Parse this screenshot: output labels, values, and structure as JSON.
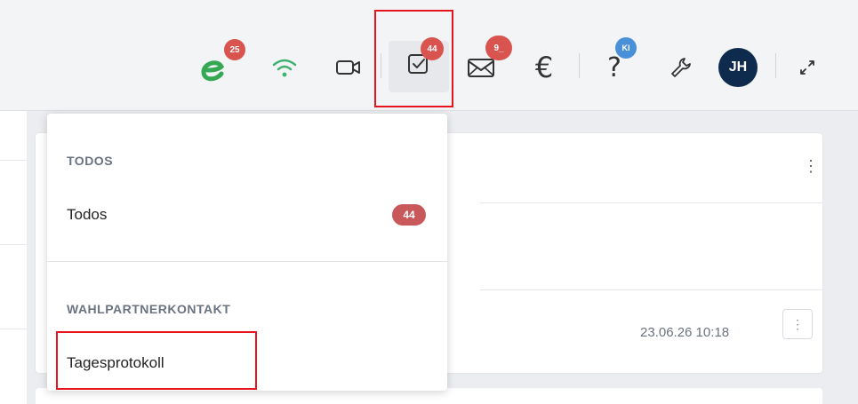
{
  "toolbar": {
    "e_badge": "25",
    "todo_badge": "44",
    "mail_badge": "9_",
    "help_badge": "KI",
    "euro_symbol": "€",
    "help_symbol": "?",
    "avatar_initials": "JH",
    "e_color": "#35a853",
    "wifi_color": "#3cb371",
    "badge_color": "#d9534f",
    "highlight_color": "#e5141d"
  },
  "dropdown": {
    "sections": [
      {
        "title": "TODOS",
        "items": [
          {
            "label": "Todos",
            "badge": "44"
          }
        ]
      },
      {
        "title": "WAHLPARTNERKONTAKT",
        "items": [
          {
            "label": "Tagesprotokoll"
          }
        ]
      }
    ]
  },
  "card": {
    "menu_glyph": "⋮",
    "timestamp": "23.06.26 10:18",
    "row_menu_glyph": "⋮"
  }
}
